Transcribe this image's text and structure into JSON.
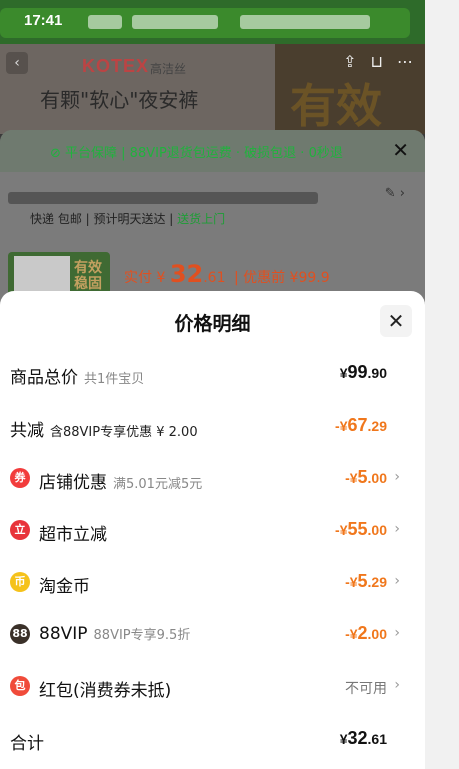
{
  "status": {
    "time": "17:41"
  },
  "banner": {
    "logo": "KOTEX",
    "logo_sub": "高洁丝",
    "slogan": "有颗\"软心\"夜安裤",
    "big_text": "有效"
  },
  "order": {
    "guarantee": "⊘ 平台保障 | 88VIP退货包运费 · 破损包退 · 0秒退",
    "delivery_a": "快递 包邮 | 预计明天送达 | ",
    "delivery_b": "送货上门",
    "thumb_text": "有效 稳固",
    "paid_prefix": "实付 ¥ ",
    "paid_int": "32",
    "paid_dec": ".61",
    "before": "| 优惠前 ¥99.9"
  },
  "sheet": {
    "title": "价格明细",
    "close": "✕",
    "rows": [
      {
        "label": "商品总价",
        "sub": "共1件宝贝",
        "cur": "¥",
        "int": "99",
        "dec": ".90"
      },
      {
        "label": "共减",
        "sub": "含88VIP专享优惠 ¥ 2.00",
        "cur": "-¥",
        "int": "67",
        "dec": ".29"
      },
      {
        "label": "店铺优惠",
        "sub": "满5.01元减5元",
        "cur": "-¥",
        "int": "5",
        "dec": ".00",
        "icon": "券"
      },
      {
        "label": "超市立减",
        "sub": "",
        "cur": "-¥",
        "int": "55",
        "dec": ".00",
        "icon": "立"
      },
      {
        "label": "淘金币",
        "sub": "",
        "cur": "-¥",
        "int": "5",
        "dec": ".29",
        "icon": "币"
      },
      {
        "label": "88VIP",
        "sub": "88VIP专享9.5折",
        "cur": "-¥",
        "int": "2",
        "dec": ".00",
        "icon": "88"
      },
      {
        "label": "红包(消费券未抵)",
        "sub": "",
        "na": "不可用",
        "icon": "包"
      },
      {
        "label": "合计",
        "sub": "",
        "cur": "¥",
        "int": "32",
        "dec": ".61"
      }
    ],
    "chevron": "›"
  },
  "colors": {
    "accent_orange": "#f0771c",
    "guarantee_green": "#20b23d"
  }
}
